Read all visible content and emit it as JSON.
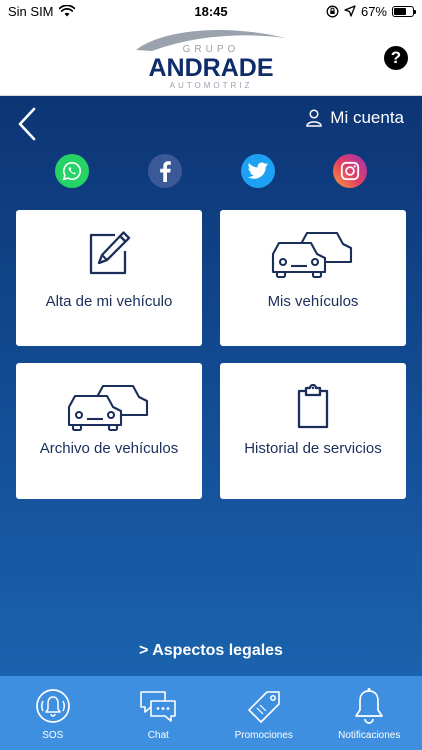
{
  "status": {
    "carrier": "Sin SIM",
    "time": "18:45",
    "battery": "67%",
    "battery_level": 0.67
  },
  "header": {
    "logo_top": "GRUPO",
    "logo_main": "ANDRADE",
    "logo_bottom": "AUTOMOTRIZ",
    "help_label": "?"
  },
  "nav": {
    "account_label": "Mi cuenta"
  },
  "social": [
    "whatsapp-icon",
    "facebook-icon",
    "twitter-icon",
    "instagram-icon"
  ],
  "cards": [
    {
      "label": "Alta de mi vehículo",
      "icon": "edit-icon"
    },
    {
      "label": "Mis vehículos",
      "icon": "cars-icon"
    },
    {
      "label": "Archivo de vehículos",
      "icon": "cars-icon"
    },
    {
      "label": "Historial de servicios",
      "icon": "clipboard-icon"
    }
  ],
  "legal_link": "> Aspectos legales",
  "tabs": [
    {
      "label": "SOS",
      "icon": "sos-bell-icon"
    },
    {
      "label": "Chat",
      "icon": "chat-icon"
    },
    {
      "label": "Promociones",
      "icon": "tag-icon"
    },
    {
      "label": "Notificaciones",
      "icon": "bell-icon"
    }
  ],
  "colors": {
    "header_bg": "#ffffff",
    "main_top": "#0d3575",
    "main_bottom": "#1a63ae",
    "tabbar_bg": "#3f8fe0",
    "card_text": "#1b2f5b",
    "brand_navy": "#0f2d6b"
  }
}
